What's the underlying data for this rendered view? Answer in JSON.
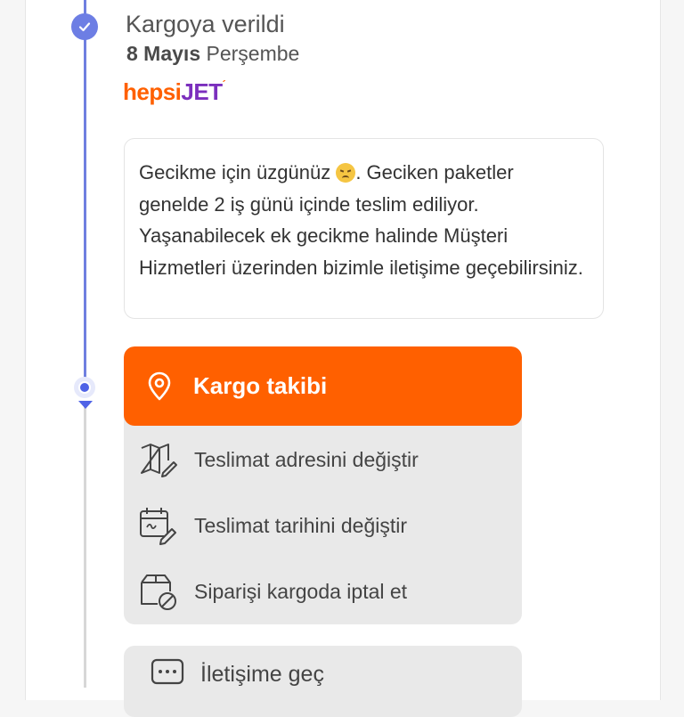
{
  "status": {
    "title": "Kargoya verildi",
    "date_bold": "8 Mayıs",
    "date_day": "Perşembe"
  },
  "carrier": {
    "logo_part1": "hepsi",
    "logo_part2": "JET",
    "logo_mark": "´"
  },
  "notice": {
    "before_emoji": "Gecikme için üzgünüz ",
    "emoji": "disappointed-face",
    "after_emoji": ". Geciken paketler genelde 2 iş günü içinde teslim ediliyor. Yaşanabilecek ek gecikme halinde Müşteri Hizmetleri üzerinden bizimle iletişime geçebilirsiniz."
  },
  "actions": {
    "primary_label": "Kargo takibi",
    "items": [
      {
        "label": "Teslimat adresini değiştir",
        "icon": "map-edit-icon"
      },
      {
        "label": "Teslimat tarihini değiştir",
        "icon": "calendar-edit-icon"
      },
      {
        "label": "Siparişi kargoda iptal et",
        "icon": "box-cancel-icon"
      }
    ]
  },
  "contact": {
    "label": "İletişime geç",
    "icon": "chat-icon"
  },
  "colors": {
    "accent": "#ff6000",
    "timeline_done": "#6f7fe0",
    "timeline_current": "#4f63e6",
    "brand_purple": "#7b2fbd"
  }
}
